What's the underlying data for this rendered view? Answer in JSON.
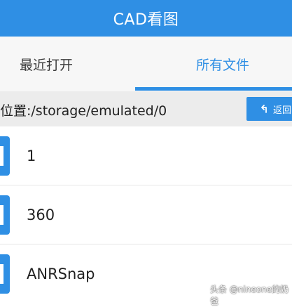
{
  "app_bar": {
    "title": "CAD看图"
  },
  "tabs": [
    {
      "label": "最近打开"
    },
    {
      "label": "所有文件"
    }
  ],
  "path_bar": {
    "path": "位置:/storage/emulated/0"
  },
  "back_button": {
    "label": "返回"
  },
  "files": [
    {
      "name": "1"
    },
    {
      "name": "360"
    },
    {
      "name": "ANRSnap"
    }
  ],
  "watermark": "头条 @nineone的奶爸",
  "colors": {
    "accent": "#2f8fe4",
    "tab_bg": "#f7f7f7",
    "path_bg": "#ececec"
  }
}
